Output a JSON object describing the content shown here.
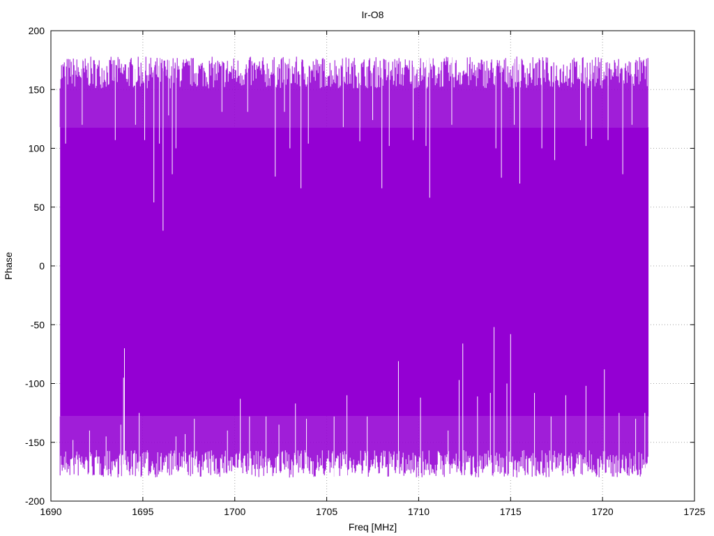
{
  "chart_data": {
    "type": "line",
    "title": "Ir-O8",
    "xlabel": "Freq [MHz]",
    "ylabel": "Phase",
    "xlim": [
      1690,
      1725
    ],
    "ylim": [
      -200,
      200
    ],
    "xticks": [
      1690,
      1695,
      1700,
      1705,
      1710,
      1715,
      1720,
      1725
    ],
    "yticks": [
      -200,
      -150,
      -100,
      -50,
      0,
      50,
      100,
      150,
      200
    ],
    "grid": true,
    "series_color": "#9400d3",
    "series": [
      {
        "x_range": [
          1690.5,
          1722.5
        ],
        "description_values": {
          "typical_max": 178,
          "typical_min": -178
        },
        "upper_dips": [
          {
            "x": 1690.8,
            "y": 104
          },
          {
            "x": 1691.7,
            "y": 120
          },
          {
            "x": 1693.5,
            "y": 107
          },
          {
            "x": 1694.6,
            "y": 120
          },
          {
            "x": 1695.1,
            "y": 107
          },
          {
            "x": 1695.6,
            "y": 54
          },
          {
            "x": 1695.9,
            "y": 104
          },
          {
            "x": 1696.1,
            "y": 30
          },
          {
            "x": 1696.4,
            "y": 128
          },
          {
            "x": 1696.6,
            "y": 78
          },
          {
            "x": 1696.8,
            "y": 100
          },
          {
            "x": 1699.3,
            "y": 131
          },
          {
            "x": 1700.7,
            "y": 131
          },
          {
            "x": 1702.2,
            "y": 76
          },
          {
            "x": 1702.7,
            "y": 131
          },
          {
            "x": 1703.0,
            "y": 100
          },
          {
            "x": 1703.6,
            "y": 66
          },
          {
            "x": 1704.0,
            "y": 104
          },
          {
            "x": 1705.9,
            "y": 118
          },
          {
            "x": 1706.8,
            "y": 106
          },
          {
            "x": 1707.5,
            "y": 124
          },
          {
            "x": 1708.0,
            "y": 66
          },
          {
            "x": 1708.4,
            "y": 102
          },
          {
            "x": 1709.7,
            "y": 107
          },
          {
            "x": 1710.4,
            "y": 102
          },
          {
            "x": 1710.6,
            "y": 58
          },
          {
            "x": 1711.8,
            "y": 120
          },
          {
            "x": 1714.2,
            "y": 100
          },
          {
            "x": 1714.5,
            "y": 75
          },
          {
            "x": 1715.2,
            "y": 120
          },
          {
            "x": 1715.5,
            "y": 70
          },
          {
            "x": 1716.7,
            "y": 100
          },
          {
            "x": 1717.4,
            "y": 90
          },
          {
            "x": 1718.8,
            "y": 124
          },
          {
            "x": 1719.1,
            "y": 102
          },
          {
            "x": 1719.4,
            "y": 108
          },
          {
            "x": 1720.3,
            "y": 107
          },
          {
            "x": 1721.1,
            "y": 78
          },
          {
            "x": 1721.6,
            "y": 120
          }
        ],
        "lower_spikes": [
          {
            "x": 1691.2,
            "y": -148
          },
          {
            "x": 1692.1,
            "y": -140
          },
          {
            "x": 1693.0,
            "y": -145
          },
          {
            "x": 1693.8,
            "y": -135
          },
          {
            "x": 1693.95,
            "y": -95
          },
          {
            "x": 1694.0,
            "y": -70
          },
          {
            "x": 1694.8,
            "y": -125
          },
          {
            "x": 1696.8,
            "y": -145
          },
          {
            "x": 1697.3,
            "y": -143
          },
          {
            "x": 1697.8,
            "y": -130
          },
          {
            "x": 1699.6,
            "y": -140
          },
          {
            "x": 1700.3,
            "y": -113
          },
          {
            "x": 1700.8,
            "y": -128
          },
          {
            "x": 1701.7,
            "y": -128
          },
          {
            "x": 1702.4,
            "y": -135
          },
          {
            "x": 1703.3,
            "y": -117
          },
          {
            "x": 1703.9,
            "y": -130
          },
          {
            "x": 1705.4,
            "y": -128
          },
          {
            "x": 1706.1,
            "y": -110
          },
          {
            "x": 1707.2,
            "y": -128
          },
          {
            "x": 1708.9,
            "y": -81
          },
          {
            "x": 1710.1,
            "y": -112
          },
          {
            "x": 1711.6,
            "y": -140
          },
          {
            "x": 1712.2,
            "y": -97
          },
          {
            "x": 1712.4,
            "y": -66
          },
          {
            "x": 1713.2,
            "y": -111
          },
          {
            "x": 1713.9,
            "y": -108
          },
          {
            "x": 1714.1,
            "y": -52
          },
          {
            "x": 1714.8,
            "y": -100
          },
          {
            "x": 1715.0,
            "y": -58
          },
          {
            "x": 1716.3,
            "y": -108
          },
          {
            "x": 1717.2,
            "y": -128
          },
          {
            "x": 1718.0,
            "y": -110
          },
          {
            "x": 1719.1,
            "y": -102
          },
          {
            "x": 1720.1,
            "y": -88
          },
          {
            "x": 1720.9,
            "y": -125
          },
          {
            "x": 1721.8,
            "y": -130
          },
          {
            "x": 1722.3,
            "y": -125
          }
        ]
      }
    ]
  }
}
